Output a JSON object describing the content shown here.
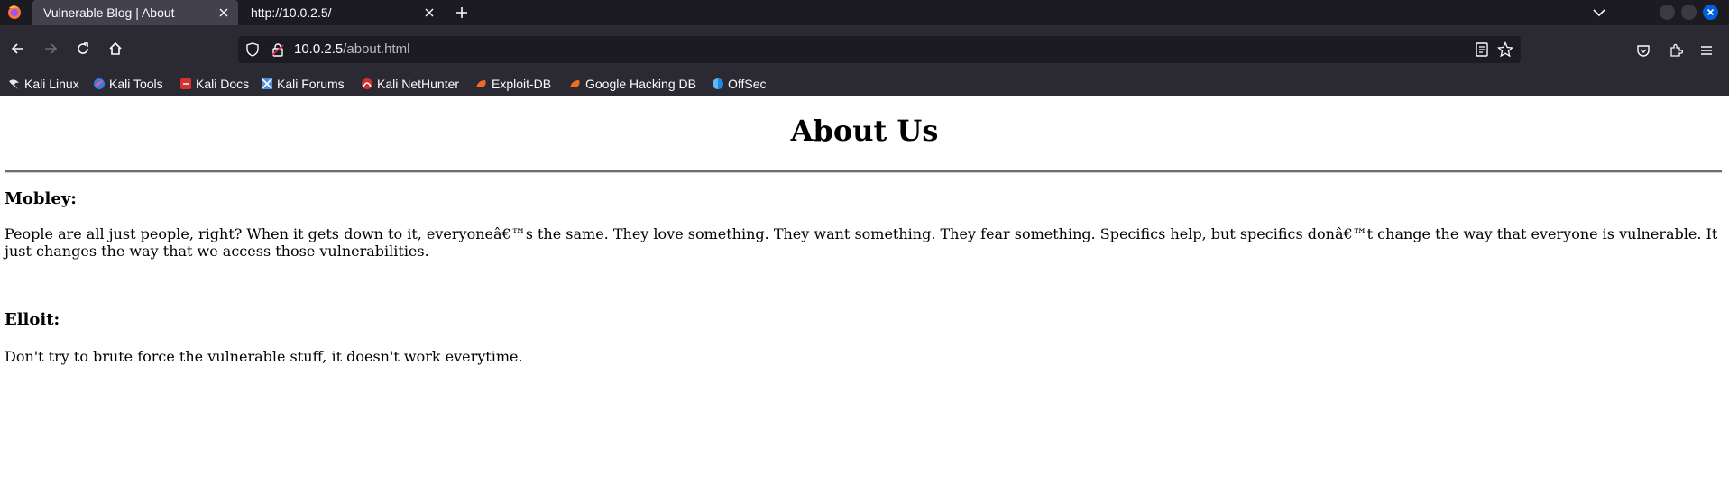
{
  "browser": {
    "tabs": [
      {
        "title": "Vulnerable Blog | About",
        "active": true
      },
      {
        "title": "http://10.0.2.5/",
        "active": false
      }
    ],
    "url": {
      "host": "10.0.2.5",
      "path": "/about.html"
    },
    "bookmarks": [
      {
        "label": "Kali Linux",
        "icon": "kali-dragon-icon"
      },
      {
        "label": "Kali Tools",
        "icon": "kali-tools-icon"
      },
      {
        "label": "Kali Docs",
        "icon": "kali-docs-icon"
      },
      {
        "label": "Kali Forums",
        "icon": "kali-forums-icon"
      },
      {
        "label": "Kali NetHunter",
        "icon": "kali-nethunter-icon"
      },
      {
        "label": "Exploit-DB",
        "icon": "exploit-db-icon"
      },
      {
        "label": "Google Hacking DB",
        "icon": "google-hacking-db-icon"
      },
      {
        "label": "OffSec",
        "icon": "offsec-icon"
      }
    ],
    "colors": {
      "tabstrip": "#1c1b22",
      "active_tab": "#42414d",
      "toolbar": "#2b2a33",
      "urlbar": "#1c1b22",
      "close_window": "#0060df"
    }
  },
  "page": {
    "title": "About Us",
    "sections": [
      {
        "heading": "Mobley:",
        "text": "People are all just people, right? When it gets down to it, everyoneâ€™s the same. They love something. They want something. They fear something. Specifics help, but specifics donâ€™t change the way that everyone is vulnerable. It just changes the way that we access those vulnerabilities."
      },
      {
        "heading": "Elloit:",
        "text": "Don't try to brute force the vulnerable stuff, it doesn't work everytime."
      }
    ]
  }
}
